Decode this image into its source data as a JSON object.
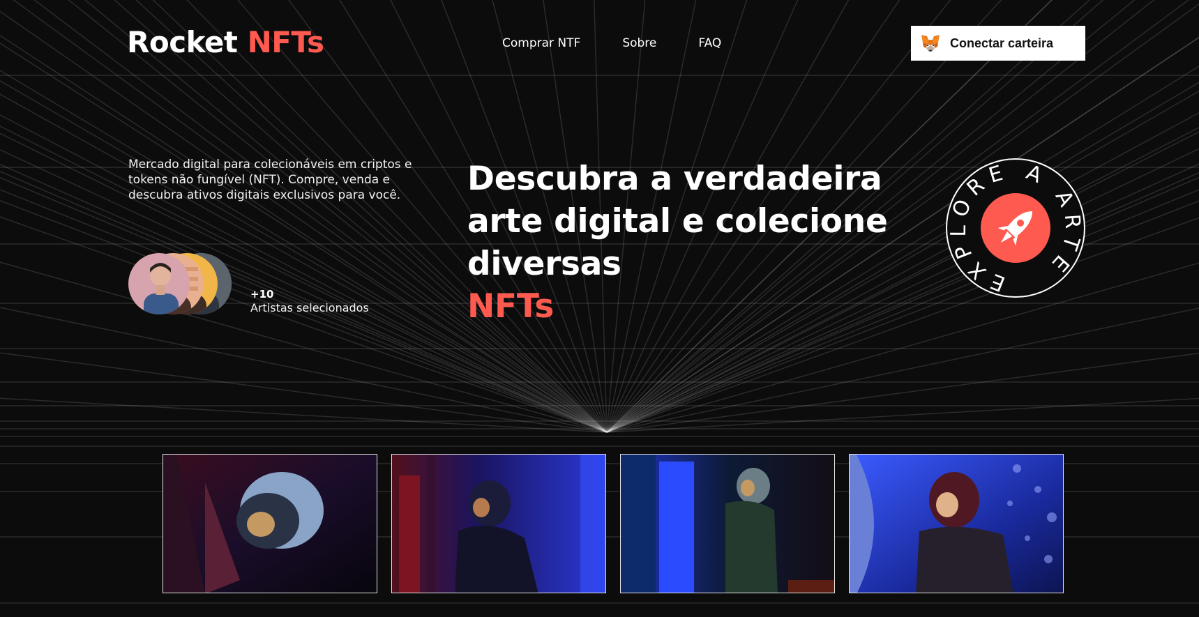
{
  "brand": {
    "name": "Rocket",
    "accent": "NFTs",
    "accent_color": "#ff5a4f"
  },
  "nav": {
    "items": [
      "Comprar NTF",
      "Sobre",
      "FAQ"
    ]
  },
  "wallet": {
    "label": "Conectar carteira",
    "icon": "metamask-fox-icon"
  },
  "hero": {
    "description": "Mercado digital para colecionáveis em criptos e tokens não fungível (NFT). Compre, venda e descubra ativos digitais exclusivos para você.",
    "artists_count": "+10",
    "artists_label": "Artistas selecionados",
    "headline": "Descubra a verdadeira arte digital e colecione diversas",
    "headline_accent": "NFTs"
  },
  "badge": {
    "text": "EXPLORE A ARTE",
    "icon": "rocket-icon"
  },
  "gallery": {
    "items": [
      "astronaut-image",
      "astronaut-image",
      "astronaut-image",
      "astronaut-image"
    ]
  },
  "colors": {
    "background": "#0c0c0c",
    "accent": "#ff5a4f",
    "text": "#ffffff"
  }
}
